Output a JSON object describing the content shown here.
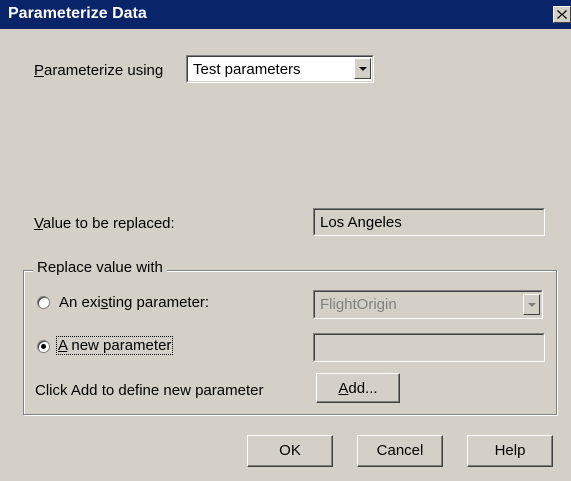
{
  "window": {
    "title": "Parameterize Data"
  },
  "parameterize_using": {
    "label_prefix": "",
    "label_underlined": "P",
    "label_rest": "arameterize using",
    "selected": "Test parameters"
  },
  "value_to_replace": {
    "label_underlined": "V",
    "label_rest": "alue to be replaced:",
    "value": "Los Angeles"
  },
  "replace_group": {
    "title": "Replace value with",
    "existing": {
      "label_pre": "An exi",
      "label_underlined": "s",
      "label_post": "ting parameter:",
      "selected": false,
      "dropdown_value": "FlightOrigin",
      "dropdown_enabled": false
    },
    "new": {
      "label_underlined": "A",
      "label_rest": " new parameter",
      "selected": true,
      "value": ""
    },
    "add_hint": "Click Add to define new parameter",
    "add_button": {
      "underlined": "A",
      "rest": "dd..."
    }
  },
  "buttons": {
    "ok": "OK",
    "cancel": "Cancel",
    "help": "Help"
  },
  "icons": {
    "close": "close-icon",
    "dropdown": "chevron-down-icon"
  },
  "colors": {
    "titlebar": "#0a246a",
    "face": "#d4d0c8",
    "disabled_text": "#808080"
  }
}
